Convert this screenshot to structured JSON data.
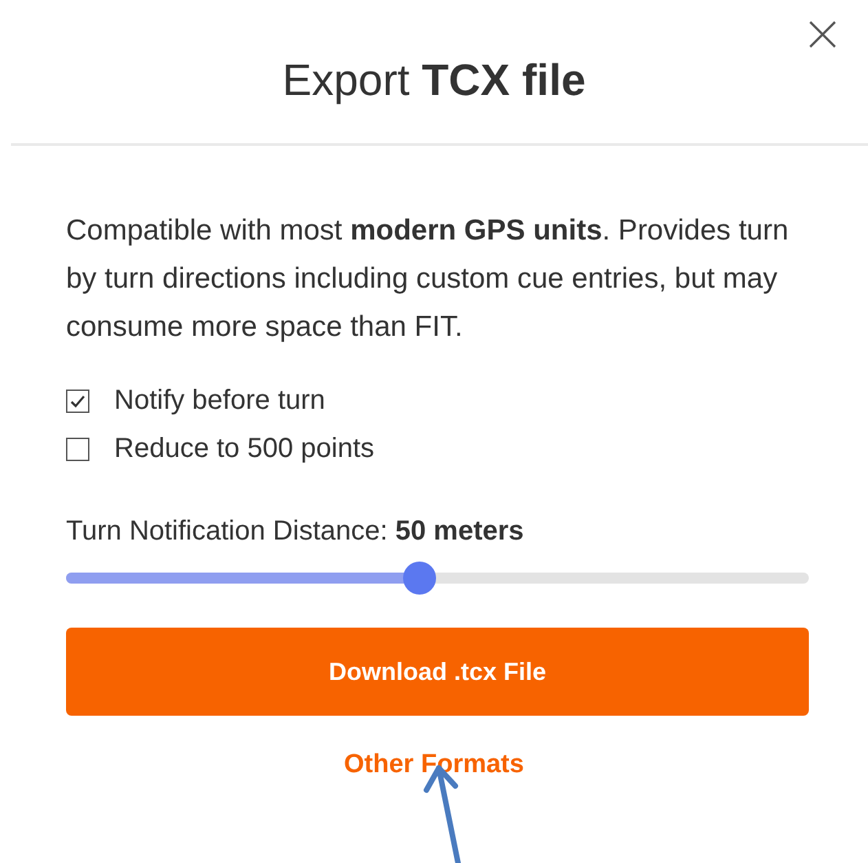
{
  "dialog": {
    "title": "Export **TCX file**",
    "description": "Compatible with most **modern GPS units**. Provides turn by turn directions including custom cue entries, but may consume more space than FIT.",
    "options": [
      {
        "label": "Notify before turn",
        "checked": true
      },
      {
        "label": "Reduce to 500 points",
        "checked": false
      }
    ],
    "slider": {
      "label": "Turn Notification Distance: **50 meters**",
      "level": 0.476
    },
    "primary_button": "Download .tcx File",
    "secondary_link": "Other Formats"
  }
}
